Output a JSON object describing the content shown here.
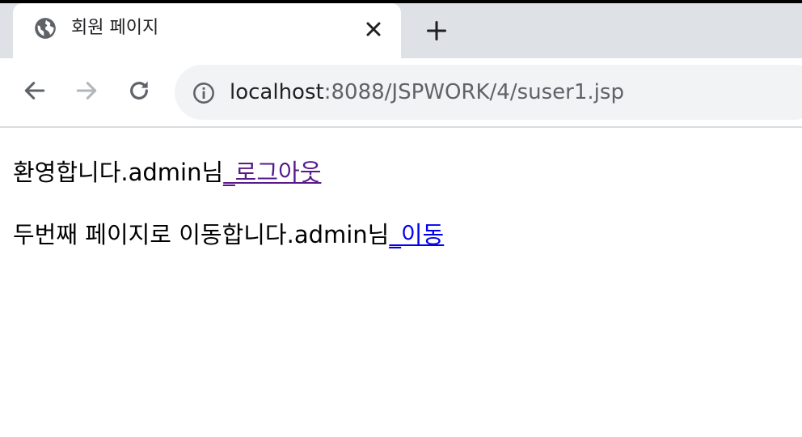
{
  "tab": {
    "title": "회원 페이지",
    "favicon": "globe-icon"
  },
  "address_bar": {
    "host": "localhost",
    "path": ":8088/JSPWORK/4/suser1.jsp"
  },
  "content": {
    "line1": {
      "text": "환영합니다.admin님",
      "link": "_로그아웃"
    },
    "line2": {
      "text": "두번째 페이지로 이동합니다.admin님",
      "link": "_이동"
    }
  },
  "colors": {
    "tabstrip": "#dee1e6",
    "omnibox": "#f1f3f4",
    "visited_link": "#551a8b",
    "link": "#0000ee"
  }
}
